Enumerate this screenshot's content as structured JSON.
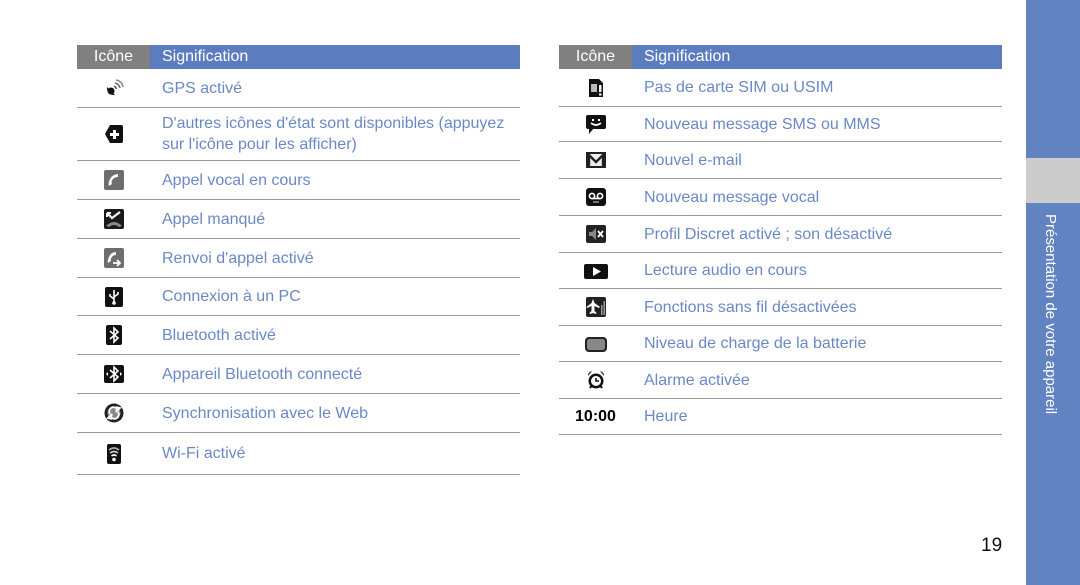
{
  "colors": {
    "header_icon_bg": "#808080",
    "header_meaning_bg": "#5b7dbf",
    "text_accent": "#6a88c8",
    "sidebar_bg": "#6283c2"
  },
  "tables": {
    "left": {
      "header": {
        "icon": "Icône",
        "meaning": "Signification"
      },
      "rows": [
        {
          "icon": "gps-icon",
          "text": "GPS activé"
        },
        {
          "icon": "more-status-icon",
          "text": "D'autres icônes d'état sont disponibles (appuyez sur l'icône pour les afficher)"
        },
        {
          "icon": "voice-call-icon",
          "text": "Appel vocal en cours"
        },
        {
          "icon": "missed-call-icon",
          "text": "Appel manqué"
        },
        {
          "icon": "call-forward-icon",
          "text": "Renvoi d'appel activé"
        },
        {
          "icon": "usb-icon",
          "text": "Connexion à un PC"
        },
        {
          "icon": "bluetooth-icon",
          "text": "Bluetooth activé"
        },
        {
          "icon": "bluetooth-connected-icon",
          "text": "Appareil Bluetooth connecté"
        },
        {
          "icon": "web-sync-icon",
          "text": "Synchronisation avec le Web"
        },
        {
          "icon": "wifi-icon",
          "text": "Wi-Fi activé"
        }
      ]
    },
    "right": {
      "header": {
        "icon": "Icône",
        "meaning": "Signification"
      },
      "rows": [
        {
          "icon": "no-sim-icon",
          "text": "Pas de carte SIM ou USIM"
        },
        {
          "icon": "sms-icon",
          "text": "Nouveau message SMS ou MMS"
        },
        {
          "icon": "email-icon",
          "text": "Nouvel e-mail"
        },
        {
          "icon": "voicemail-icon",
          "text": "Nouveau message vocal"
        },
        {
          "icon": "mute-icon",
          "text": "Profil Discret activé ; son désactivé"
        },
        {
          "icon": "play-icon",
          "text": "Lecture audio en cours"
        },
        {
          "icon": "airplane-mode-icon",
          "text": "Fonctions sans fil désactivées"
        },
        {
          "icon": "battery-icon",
          "text": "Niveau de charge de la batterie"
        },
        {
          "icon": "alarm-icon",
          "text": "Alarme activée"
        },
        {
          "icon": "time-label",
          "icon_text": "10:00",
          "text": "Heure"
        }
      ]
    }
  },
  "sidebar": {
    "label": "Présentation de votre appareil"
  },
  "page_number": "19"
}
